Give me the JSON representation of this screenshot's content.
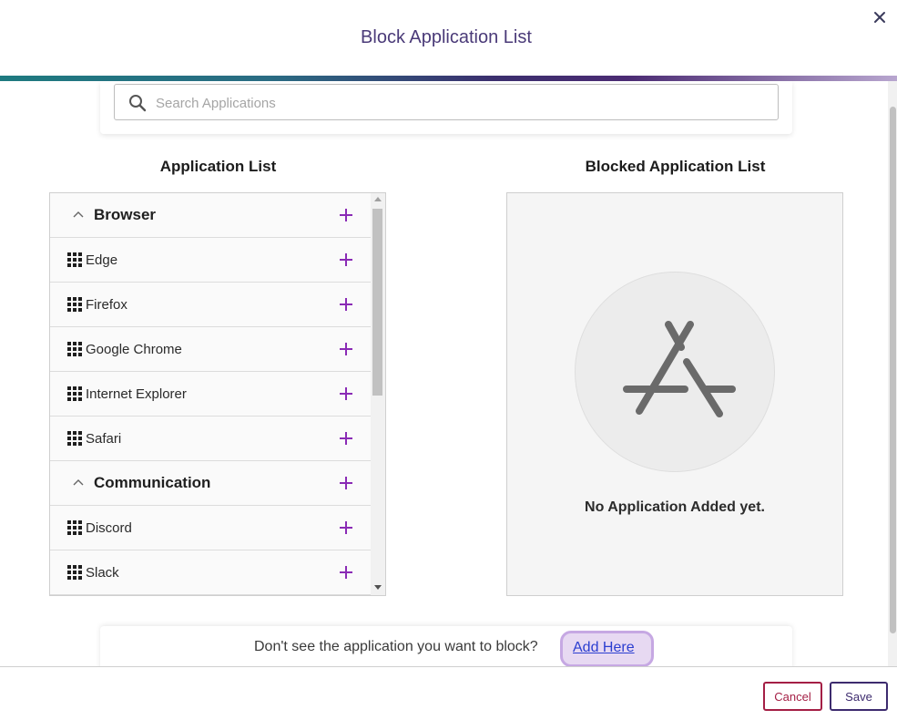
{
  "dialog": {
    "title": "Block Application List"
  },
  "search": {
    "placeholder": "Search Applications",
    "value": ""
  },
  "application_list": {
    "heading": "Application List",
    "rows": [
      {
        "type": "category",
        "label": "Browser"
      },
      {
        "type": "app",
        "label": "Edge"
      },
      {
        "type": "app",
        "label": "Firefox"
      },
      {
        "type": "app",
        "label": "Google Chrome"
      },
      {
        "type": "app",
        "label": "Internet Explorer"
      },
      {
        "type": "app",
        "label": "Safari"
      },
      {
        "type": "category",
        "label": "Communication"
      },
      {
        "type": "app",
        "label": "Discord"
      },
      {
        "type": "app",
        "label": "Slack"
      }
    ]
  },
  "blocked_list": {
    "heading": "Blocked Application List",
    "empty_message": "No Application Added yet."
  },
  "footer": {
    "prompt": "Don't see the application you want to block?",
    "link_label": "Add Here"
  },
  "actions": {
    "cancel_label": "Cancel",
    "save_label": "Save"
  },
  "colors": {
    "title": "#4a3a78",
    "plus_accent": "#8a2bb5",
    "cancel": "#a41f45",
    "save": "#3d2b6e",
    "link": "#2b3ed0",
    "link_highlight": "#c6a8e3"
  },
  "icons": {
    "close": "close-icon",
    "search": "search-icon",
    "category_toggle": "chevron-up-icon",
    "app": "grid-icon",
    "add": "plus-icon",
    "empty_state": "app-store-icon"
  }
}
